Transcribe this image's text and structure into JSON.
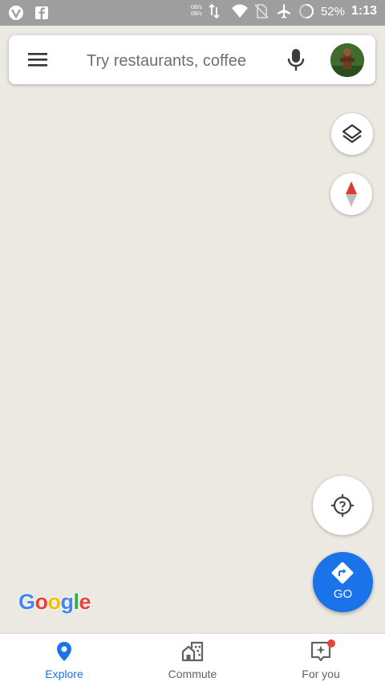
{
  "status_bar": {
    "net_up": "0B/s",
    "net_down": "0B/s",
    "battery": "52%",
    "time": "1:13",
    "icons": [
      "vivaldi-icon",
      "facebook-icon",
      "data-arrows-icon",
      "wifi-icon",
      "no-sim-icon",
      "airplane-icon",
      "battery-icon"
    ]
  },
  "search": {
    "placeholder": "Try restaurants, coffee",
    "value": ""
  },
  "buttons": {
    "go_label": "GO"
  },
  "brand": {
    "logo_letters": [
      "G",
      "o",
      "o",
      "g",
      "l",
      "e"
    ],
    "logo_colors": [
      "#4285f4",
      "#ea4335",
      "#fbbc05",
      "#4285f4",
      "#34a853",
      "#ea4335"
    ]
  },
  "bottom_nav": {
    "items": [
      {
        "label": "Explore",
        "icon": "pin-icon",
        "active": true
      },
      {
        "label": "Commute",
        "icon": "commute-icon",
        "active": false
      },
      {
        "label": "For you",
        "icon": "for-you-icon",
        "active": false
      }
    ]
  },
  "colors": {
    "accent": "#1a73e8",
    "map_bg": "#ece9e2",
    "status_bar": "#9e9e9e",
    "compass_red": "#db3b30"
  }
}
